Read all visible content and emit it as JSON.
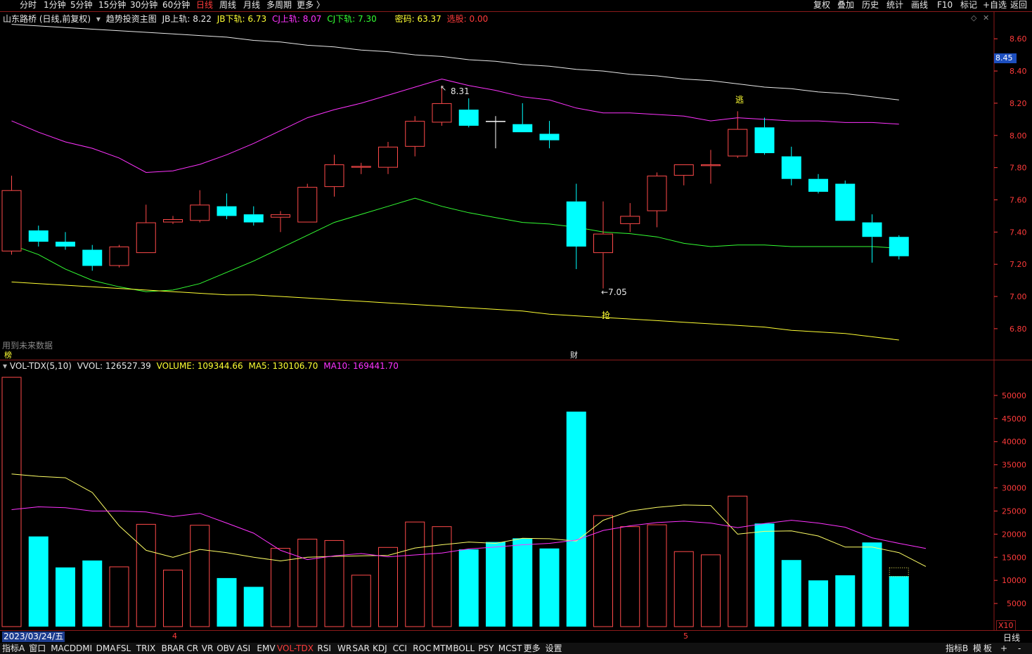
{
  "toolbar": {
    "timeframes": [
      "分时",
      "1分钟",
      "5分钟",
      "15分钟",
      "30分钟",
      "60分钟",
      "日线",
      "周线",
      "月线",
      "多周期",
      "更多 〉"
    ],
    "active": "日线",
    "right_buttons": [
      "复权",
      "叠加",
      "历史",
      "统计",
      "画线",
      "F10",
      "标记",
      "+自选",
      "返回"
    ]
  },
  "main_info": {
    "stock": "山东路桥",
    "mode": "(日线,前复权)",
    "indicator": "趋势投资主图",
    "jb_upper": "JB上轨: 8.22",
    "jb_lower": "JB下轨: 6.73",
    "cj_upper": "CJ上轨: 8.07",
    "cj_lower": "CJ下轨: 7.30",
    "mima": "密码: 63.37",
    "xuangu": "选股: 0.00"
  },
  "notes": {
    "future_data": "用到未来数据",
    "bang": "榜",
    "cai": "财",
    "qiang": "抢",
    "tao": "逃",
    "high_label": "8.31",
    "low_label": "←7.05",
    "current_price": "8.45"
  },
  "vol_info": {
    "name": "VOL-TDX(5,10)",
    "vvol": "VVOL: 126527.39",
    "volume": "VOLUME: 109344.66",
    "ma5": "MA5: 130106.70",
    "ma10": "MA10: 169441.70",
    "scale": "X10"
  },
  "datebar": {
    "date": "2023/03/24/五",
    "month4": "4",
    "month5": "5",
    "period": "日线"
  },
  "bottom_tabs": [
    "指标A",
    "窗口",
    "MACD",
    "DMI",
    "DMA",
    "FSL",
    "TRIX",
    "BRAR",
    "CR",
    "VR",
    "OBV",
    "ASI",
    "EMV",
    "VOL-TDX",
    "RSI",
    "WR",
    "SAR",
    "KDJ",
    "CCI",
    "ROC",
    "MTM",
    "BOLL",
    "PSY",
    "MCST",
    "更多",
    "设置"
  ],
  "bottom_active": "VOL-TDX",
  "bottom_right": [
    "指标B",
    "模",
    "板",
    "+",
    "-"
  ],
  "colors": {
    "up": "#ff4a4a",
    "down": "#00ffff",
    "cross": "#ffffff",
    "jb_upper": "#e8e8e8",
    "cj_upper": "#ff33ff",
    "cj_lower": "#33ff33",
    "jb_lower": "#ffff33",
    "ma5": "#ffff66",
    "ma10": "#ff33ff",
    "axis": "#ff3b3b"
  },
  "chart_data": [
    {
      "type": "candlestick",
      "title": "山东路桥 (日线,前复权) 趋势投资主图",
      "ylim": [
        6.66,
        8.71
      ],
      "y_ticks": [
        6.8,
        7.0,
        7.2,
        7.4,
        7.6,
        7.8,
        8.0,
        8.2,
        8.4,
        8.6
      ],
      "candles": [
        {
          "o": 7.28,
          "h": 7.75,
          "l": 7.26,
          "c": 7.66
        },
        {
          "o": 7.41,
          "h": 7.44,
          "l": 7.31,
          "c": 7.34
        },
        {
          "o": 7.34,
          "h": 7.4,
          "l": 7.29,
          "c": 7.31
        },
        {
          "o": 7.29,
          "h": 7.32,
          "l": 7.16,
          "c": 7.19
        },
        {
          "o": 7.19,
          "h": 7.32,
          "l": 7.18,
          "c": 7.31
        },
        {
          "o": 7.27,
          "h": 7.57,
          "l": 7.27,
          "c": 7.46
        },
        {
          "o": 7.46,
          "h": 7.5,
          "l": 7.45,
          "c": 7.48
        },
        {
          "o": 7.47,
          "h": 7.66,
          "l": 7.46,
          "c": 7.57
        },
        {
          "o": 7.56,
          "h": 7.64,
          "l": 7.48,
          "c": 7.5
        },
        {
          "o": 7.51,
          "h": 7.56,
          "l": 7.44,
          "c": 7.46
        },
        {
          "o": 7.49,
          "h": 7.53,
          "l": 7.4,
          "c": 7.51
        },
        {
          "o": 7.46,
          "h": 7.7,
          "l": 7.46,
          "c": 7.68
        },
        {
          "o": 7.68,
          "h": 7.88,
          "l": 7.62,
          "c": 7.82
        },
        {
          "o": 7.8,
          "h": 7.83,
          "l": 7.76,
          "c": 7.81
        },
        {
          "o": 7.8,
          "h": 7.96,
          "l": 7.76,
          "c": 7.93
        },
        {
          "o": 7.93,
          "h": 8.12,
          "l": 7.87,
          "c": 8.09
        },
        {
          "o": 8.08,
          "h": 8.31,
          "l": 8.06,
          "c": 8.2
        },
        {
          "o": 8.16,
          "h": 8.23,
          "l": 8.05,
          "c": 8.06
        },
        {
          "o": 8.09,
          "h": 8.12,
          "l": 7.92,
          "c": 8.09
        },
        {
          "o": 8.07,
          "h": 8.2,
          "l": 8.02,
          "c": 8.02
        },
        {
          "o": 8.01,
          "h": 8.09,
          "l": 7.92,
          "c": 7.97
        },
        {
          "o": 7.59,
          "h": 7.7,
          "l": 7.17,
          "c": 7.31
        },
        {
          "o": 7.27,
          "h": 7.59,
          "l": 7.05,
          "c": 7.39
        },
        {
          "o": 7.45,
          "h": 7.58,
          "l": 7.4,
          "c": 7.5
        },
        {
          "o": 7.53,
          "h": 7.77,
          "l": 7.43,
          "c": 7.75
        },
        {
          "o": 7.75,
          "h": 7.82,
          "l": 7.69,
          "c": 7.82
        },
        {
          "o": 7.81,
          "h": 7.91,
          "l": 7.7,
          "c": 7.82
        },
        {
          "o": 7.87,
          "h": 8.15,
          "l": 7.86,
          "c": 8.04
        },
        {
          "o": 8.05,
          "h": 8.11,
          "l": 7.88,
          "c": 7.89
        },
        {
          "o": 7.87,
          "h": 7.93,
          "l": 7.69,
          "c": 7.73
        },
        {
          "o": 7.73,
          "h": 7.76,
          "l": 7.64,
          "c": 7.65
        },
        {
          "o": 7.7,
          "h": 7.72,
          "l": 7.47,
          "c": 7.47
        },
        {
          "o": 7.46,
          "h": 7.51,
          "l": 7.21,
          "c": 7.37
        },
        {
          "o": 7.37,
          "h": 7.38,
          "l": 7.23,
          "c": 7.25
        }
      ],
      "series": [
        {
          "name": "JB上轨",
          "values": [
            8.69,
            8.68,
            8.67,
            8.66,
            8.65,
            8.64,
            8.63,
            8.62,
            8.61,
            8.59,
            8.58,
            8.56,
            8.55,
            8.53,
            8.52,
            8.5,
            8.49,
            8.47,
            8.46,
            8.44,
            8.43,
            8.41,
            8.4,
            8.38,
            8.37,
            8.35,
            8.34,
            8.32,
            8.3,
            8.29,
            8.27,
            8.26,
            8.24,
            8.22
          ]
        },
        {
          "name": "CJ上轨",
          "values": [
            8.09,
            8.02,
            7.96,
            7.92,
            7.86,
            7.77,
            7.78,
            7.82,
            7.88,
            7.95,
            8.03,
            8.11,
            8.16,
            8.2,
            8.25,
            8.3,
            8.35,
            8.31,
            8.28,
            8.24,
            8.22,
            8.17,
            8.14,
            8.14,
            8.13,
            8.12,
            8.09,
            8.11,
            8.1,
            8.09,
            8.09,
            8.08,
            8.08,
            8.07
          ]
        },
        {
          "name": "CJ下轨",
          "values": [
            7.32,
            7.26,
            7.17,
            7.1,
            7.06,
            7.03,
            7.04,
            7.08,
            7.15,
            7.22,
            7.3,
            7.38,
            7.46,
            7.51,
            7.56,
            7.61,
            7.56,
            7.52,
            7.49,
            7.46,
            7.45,
            7.43,
            7.4,
            7.39,
            7.37,
            7.33,
            7.31,
            7.32,
            7.32,
            7.31,
            7.31,
            7.31,
            7.31,
            7.3
          ]
        },
        {
          "name": "JB下轨",
          "values": [
            7.09,
            7.08,
            7.07,
            7.06,
            7.05,
            7.04,
            7.03,
            7.02,
            7.01,
            7.01,
            7.0,
            6.99,
            6.98,
            6.97,
            6.96,
            6.95,
            6.94,
            6.93,
            6.92,
            6.91,
            6.89,
            6.88,
            6.87,
            6.86,
            6.85,
            6.84,
            6.83,
            6.82,
            6.81,
            6.79,
            6.78,
            6.77,
            6.75,
            6.73
          ]
        }
      ]
    },
    {
      "type": "bar",
      "title": "VOL-TDX(5,10)",
      "ylim": [
        0,
        55000
      ],
      "y_ticks": [
        5000,
        10000,
        15000,
        20000,
        25000,
        30000,
        35000,
        40000,
        45000,
        50000
      ],
      "values": [
        54000,
        19500,
        12800,
        14300,
        13000,
        22200,
        12300,
        22000,
        10500,
        8600,
        17000,
        19000,
        18700,
        11200,
        17200,
        22700,
        21700,
        16700,
        18300,
        19100,
        16900,
        46500,
        24100,
        21700,
        22100,
        16300,
        15600,
        28300,
        22300,
        14400,
        10000,
        11100,
        18200,
        10900
      ],
      "series": [
        {
          "name": "MA5",
          "values": [
            33000,
            32500,
            32200,
            29000,
            21800,
            16500,
            15000,
            16700,
            16000,
            15000,
            14200,
            15000,
            15200,
            15300,
            15400,
            17000,
            17700,
            18300,
            18000,
            19100,
            19000,
            18500,
            23000,
            25000,
            25800,
            26300,
            26200,
            20000,
            20600,
            20700,
            19600,
            17200,
            17200,
            16000,
            13000
          ]
        },
        {
          "name": "MA10",
          "values": [
            25300,
            25900,
            25700,
            25000,
            25000,
            24800,
            23800,
            24500,
            22400,
            20200,
            16500,
            14500,
            15300,
            15800,
            15100,
            15500,
            15900,
            16800,
            17200,
            17700,
            18000,
            18700,
            20800,
            21800,
            22500,
            22800,
            22400,
            21400,
            22300,
            23000,
            22400,
            21500,
            19200,
            18000,
            16900
          ]
        }
      ]
    }
  ]
}
